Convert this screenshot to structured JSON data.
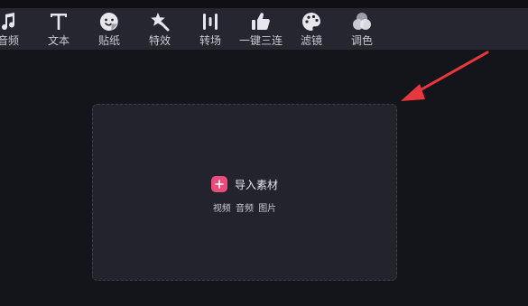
{
  "toolbar": {
    "items": [
      {
        "label": "音频",
        "icon": "music-note-icon"
      },
      {
        "label": "文本",
        "icon": "text-t-icon"
      },
      {
        "label": "贴纸",
        "icon": "sticker-face-icon"
      },
      {
        "label": "特效",
        "icon": "star-magic-icon"
      },
      {
        "label": "转场",
        "icon": "transition-bars-icon"
      },
      {
        "label": "一键三连",
        "icon": "thumbs-up-icon"
      },
      {
        "label": "滤镜",
        "icon": "palette-icon"
      },
      {
        "label": "调色",
        "icon": "color-circles-icon"
      }
    ]
  },
  "dropzone": {
    "import_label": "导入素材",
    "types": [
      "视频",
      "音频",
      "图片"
    ]
  },
  "colors": {
    "accent": "#ea4d7b",
    "arrow": "#e8383d",
    "toolbar_bg": "#25262f",
    "page_bg": "#14141b"
  }
}
